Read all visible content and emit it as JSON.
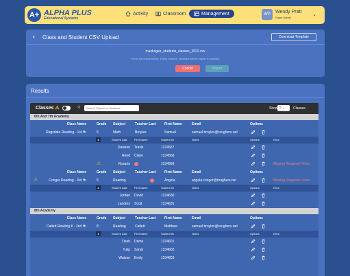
{
  "header": {
    "logo_mark": "A+",
    "logo_title": "ALPHA PLUS",
    "logo_subtitle": "Educational Systems",
    "nav": [
      {
        "label": "Activity",
        "icon": "home-icon"
      },
      {
        "label": "Classroom",
        "icon": "book-icon"
      },
      {
        "label": "Management",
        "icon": "table-icon",
        "active": true
      }
    ],
    "user": {
      "initials": "WP",
      "name": "Wendy Pratt",
      "role": "Super Admin"
    }
  },
  "upload": {
    "title": "Class and Student CSV Upload",
    "download_label": "Download Template",
    "file_name": "muskogee_students_classes_2022.csv",
    "error_message": "There are errors below. These must be resolved before Import is enabled.",
    "cancel_label": "Cancel",
    "import_label": "Import"
  },
  "results": {
    "title": "Results",
    "toolbar": {
      "label": "Classes",
      "search_placeholder": "Search Classes or Students",
      "show_label": "Show",
      "show_value": "5",
      "show_after": "Classes"
    },
    "class_headers": [
      "Class Name",
      "Grade",
      "Subject",
      "Teacher Last",
      "First Name",
      "Email",
      "Options"
    ],
    "student_headers": [
      "Student Last",
      "First Name",
      "Student ID",
      "Notes",
      "Options",
      "Error"
    ],
    "groups": [
      {
        "label": "6th And 7th Academy",
        "classes": [
          {
            "class_name": "Ragsdale Reading - 1st Hr",
            "grade": "6",
            "subject": "Math",
            "teacher_last": "Broyles",
            "first_name": "Samuel",
            "email": "samuel.broyles@roughers.net",
            "warn": false,
            "student_count": "3",
            "students": [
              {
                "last": "Dawson",
                "first": "Travis",
                "id": "1234567",
                "error": "",
                "warn": false
              },
              {
                "last": "Reed",
                "first": "Claire",
                "id": "1234568",
                "error": "",
                "warn": false
              },
              {
                "last": "Rosario",
                "first": "",
                "id": "1234569",
                "error": "Missing Required Fields",
                "warn": true
              }
            ]
          },
          {
            "class_name": "Conger Reading - 3rd Hr",
            "grade": "6",
            "subject": "Reading",
            "teacher_last": "",
            "first_name": "Angela",
            "email": "angela.conger@roughers.net",
            "warn": true,
            "class_error": "Missing Required Fields",
            "student_count": "2",
            "students": [
              {
                "last": "Jordan",
                "first": "David",
                "id": "1234630",
                "error": "",
                "warn": false
              },
              {
                "last": "Landers",
                "first": "Scott",
                "id": "1234631",
                "error": "",
                "warn": false
              }
            ]
          }
        ]
      },
      {
        "label": "8th Academy",
        "classes": [
          {
            "class_name": "Catlett Reading II - 2nd Hr",
            "grade": "8",
            "subject": "Reading",
            "teacher_last": "Catlett",
            "first_name": "Matthew",
            "email": "samuel.broyles@roughers.net",
            "warn": false,
            "student_count": "3",
            "students": [
              {
                "last": "Dash",
                "first": "Dame",
                "id": "1234601",
                "error": "",
                "warn": false
              },
              {
                "last": "Tulip",
                "first": "Sarah",
                "id": "1234602",
                "error": "",
                "warn": false
              },
              {
                "last": "Watson",
                "first": "Emily",
                "id": "1234603",
                "error": "",
                "warn": false
              }
            ]
          }
        ]
      }
    ]
  },
  "colors": {
    "background": "#2a5090",
    "header": "#fde07a",
    "card": "#4a72c0",
    "cancel": "#f06f6f",
    "import": "#5aa1b9",
    "error": "#f07a7a",
    "warning": "#f5c518"
  }
}
